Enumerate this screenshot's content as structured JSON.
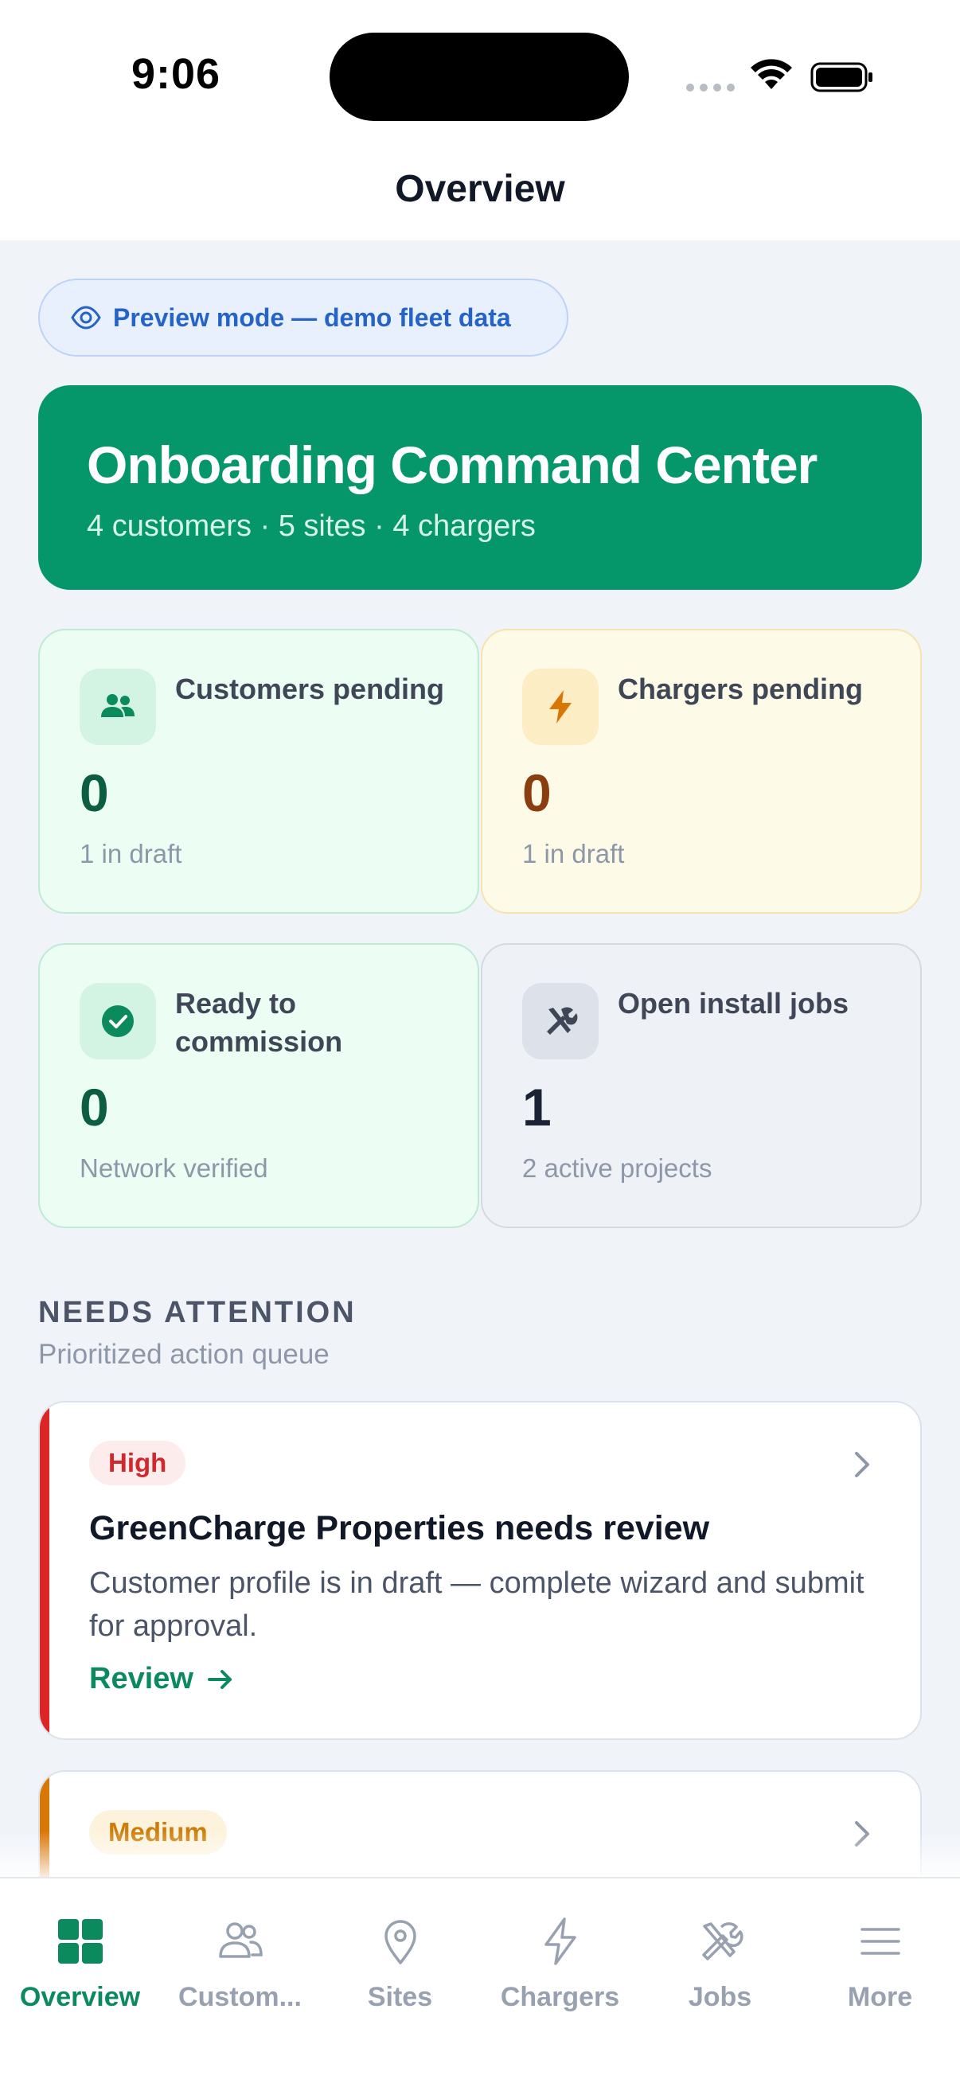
{
  "status_bar": {
    "time": "9:06"
  },
  "nav": {
    "title": "Overview"
  },
  "preview": {
    "label": "Preview mode — demo fleet data"
  },
  "hero": {
    "title": "Onboarding Command Center",
    "subtitle": "4 customers · 5 sites · 4 chargers"
  },
  "stats": [
    {
      "label": "Customers pending",
      "value": "0",
      "note": "1 in draft",
      "icon": "users-icon",
      "tone": "green"
    },
    {
      "label": "Chargers pending",
      "value": "0",
      "note": "1 in draft",
      "icon": "lightning-icon",
      "tone": "amber"
    },
    {
      "label": "Ready to commission",
      "value": "0",
      "note": "Network verified",
      "icon": "check-circle-icon",
      "tone": "green"
    },
    {
      "label": "Open install jobs",
      "value": "1",
      "note": "2 active projects",
      "icon": "tools-icon",
      "tone": "gray"
    }
  ],
  "section": {
    "title": "NEEDS ATTENTION",
    "subtitle": "Prioritized action queue"
  },
  "attention": [
    {
      "priority": "High",
      "title": "GreenCharge Properties needs review",
      "body": "Customer profile is in draft — complete wizard and submit for approval.",
      "action": "Review",
      "stripe_color": "#dc2626"
    },
    {
      "priority": "Medium",
      "stripe_color": "#d97706"
    }
  ],
  "tabs": [
    {
      "label": "Overview",
      "icon": "grid-icon",
      "active": true
    },
    {
      "label": "Custom...",
      "icon": "users-icon",
      "active": false
    },
    {
      "label": "Sites",
      "icon": "map-pin-icon",
      "active": false
    },
    {
      "label": "Chargers",
      "icon": "lightning-icon",
      "active": false
    },
    {
      "label": "Jobs",
      "icon": "tools-icon",
      "active": false
    },
    {
      "label": "More",
      "icon": "menu-icon",
      "active": false
    }
  ],
  "colors": {
    "brand": "#059669",
    "accent_text": "#0b8a5e",
    "high": "#dc2626",
    "medium": "#d97706",
    "preview": "#2563c9"
  }
}
